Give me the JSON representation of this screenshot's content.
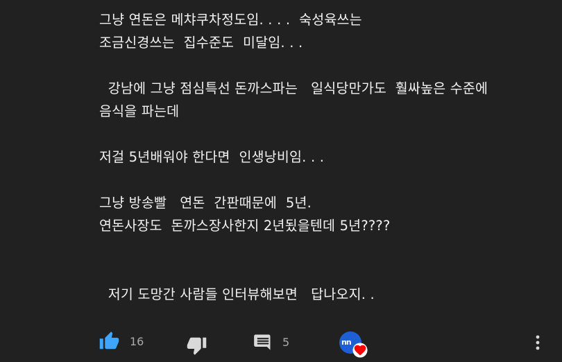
{
  "comment": {
    "lines": [
      "그냥 연돈은 메챠쿠차정도임. . . .  숙성육쓰는",
      "조금신경쓰는  집수준도  미달임. . .",
      "",
      "  강남에 그냥 점심특선 돈까스파는   일식당만가도  훨싸높은 수준에",
      "음식을 파는데",
      "",
      "저걸 5년배워야 한다면  인생낭비임. . .",
      "",
      "그냥 방송빨   연돈  간판때문에  5년.",
      "연돈사장도  돈까스장사한지 2년됬을텐데 5년????",
      "",
      "",
      "  저기 도망간 사람들 인터뷰해보면   답나오지. ."
    ]
  },
  "actions": {
    "like_count": "16",
    "reply_count": "5",
    "like_icon": "thumb-up-filled-icon",
    "dislike_icon": "thumb-down-icon",
    "reply_icon": "comment-icon",
    "heart_badge": "creator-heart-icon",
    "more_icon": "more-vertical-icon",
    "avatar_text": "nn"
  },
  "colors": {
    "background": "#212121",
    "text": "#f1f1f1",
    "icon": "#d9d9d9",
    "like_active": "#3ea6ff",
    "heart": "#ff0000",
    "avatar": "#1f5fd6"
  }
}
